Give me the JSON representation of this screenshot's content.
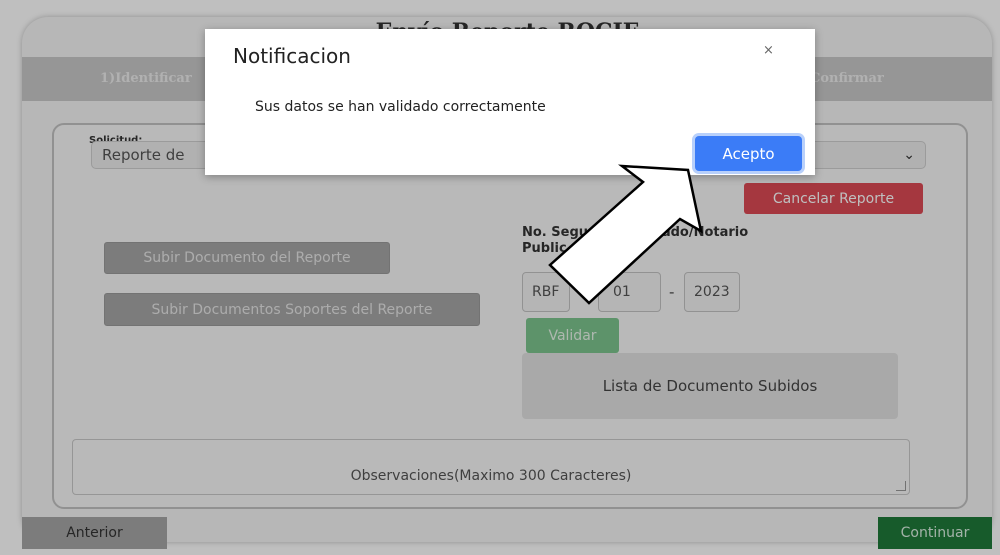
{
  "app": {
    "title": "Envío Reporte ROCIF",
    "steps": [
      "1)Identificar",
      "Confirmar"
    ]
  },
  "form": {
    "solicitud_label": "Solicitud:",
    "solicitud_value": "Reporte de",
    "cancel_button": "Cancelar Reporte",
    "upload_report_button": "Subir Documento del Reporte",
    "upload_supports_button": "Subir Documentos Soportes del Reporte",
    "seguro_label_line1": "No. Segu        Abogado/Notario",
    "seguro_label_line2": "Public",
    "seguro_prefix": "RBF",
    "seguro_number": "01",
    "seguro_year": "2023",
    "dash": "-",
    "validate_button": "Validar",
    "documents_list": "Lista de Documento Subidos",
    "observaciones_placeholder": "Observaciones(Maximo 300 Caracteres)"
  },
  "nav": {
    "previous_button": "Anterior",
    "continue_button": "Continuar"
  },
  "modal": {
    "title": "Notificacion",
    "close_symbol": "×",
    "message": "Sus datos se han validado correctamente",
    "accept_button": "Acepto"
  },
  "colors": {
    "cancel_red": "#dc4a55",
    "accept_blue": "#3b7cf7",
    "continue_green": "#1f7a3a",
    "validate_green": "#7cc48e"
  },
  "icons": {
    "chevron": "chevron-down-icon",
    "pointer_arrow": "arrow-icon"
  }
}
